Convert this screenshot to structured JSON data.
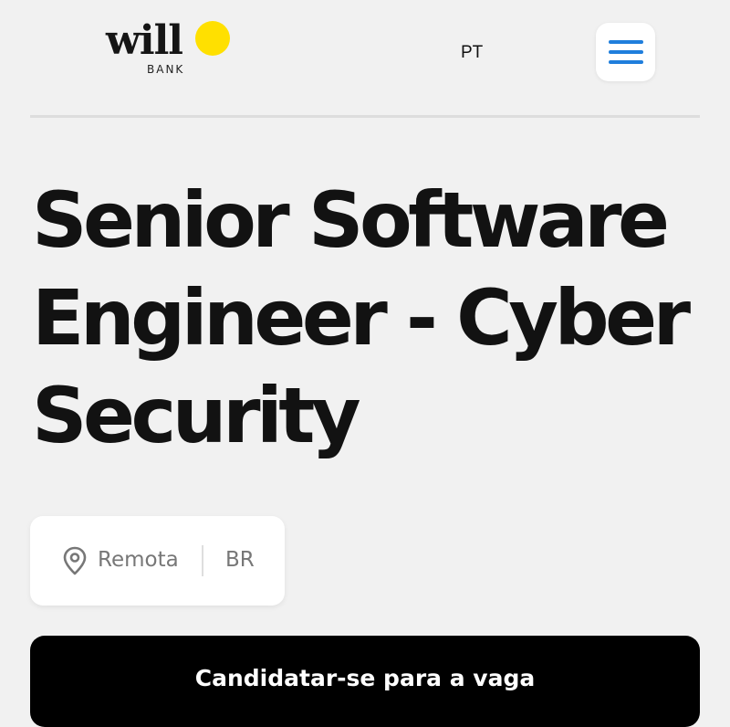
{
  "header": {
    "logo": {
      "word": "will",
      "sub": "BANK",
      "sun_color": "#FFE000"
    },
    "language": "PT",
    "menu_icon": "hamburger-menu-icon",
    "menu_color": "#1F7EDC"
  },
  "job": {
    "title": "Senior Software Engineer - Cyber Security",
    "location_icon": "map-pin-icon",
    "location": "Remota",
    "country": "BR"
  },
  "cta": {
    "apply_label": "Candidatar-se para a vaga"
  }
}
